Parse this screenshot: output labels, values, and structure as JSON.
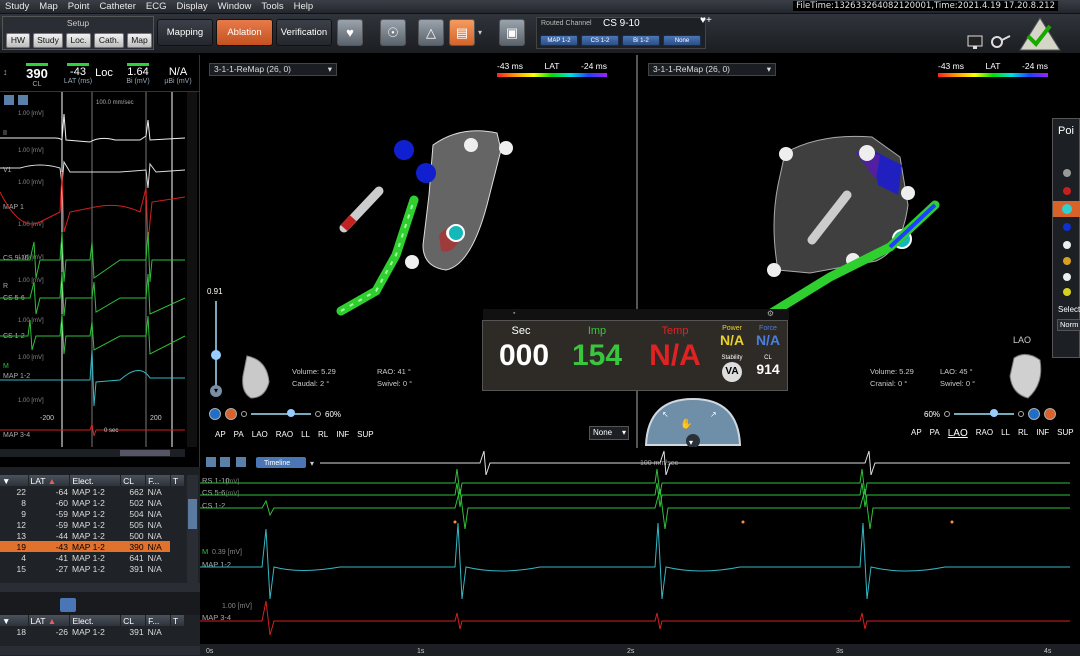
{
  "menubar": {
    "items": [
      "Study",
      "Map",
      "Point",
      "Catheter",
      "ECG",
      "Display",
      "Window",
      "Tools",
      "Help"
    ],
    "filetime": "FileTime:132633264082120001,Time:2021.4.19 17.20.8.212"
  },
  "toolbar": {
    "setup_label": "Setup",
    "setup_buttons": [
      "HW",
      "Study",
      "Loc.",
      "Cath.",
      "Map"
    ],
    "modes": [
      "Mapping",
      "Ablation",
      "Verification"
    ],
    "active_mode": "Ablation",
    "routed_label": "Routed Channel",
    "routed_value": "CS 9-10",
    "routed_buttons": [
      "MAP 1-2",
      "CS 1-2",
      "Bi 1-2",
      "None"
    ],
    "accent": "#d9622b"
  },
  "readout": {
    "cl_value": "390",
    "cl_label": "CL",
    "lat_value": "-43",
    "lat_label": "LAT (ms)",
    "loc_value": "Loc",
    "bi_value": "1.64",
    "bi_label": "Bi (mV)",
    "ubi_value": "N/A",
    "ubi_label": "µBi (mV)"
  },
  "left_ecg": {
    "speed": "100.0 mm/sec",
    "scale_labels": [
      "1.00 [mV]",
      "1.00 [mV]",
      "1.00 [mV]",
      "1.00 [mV]",
      "1.00 [mV]",
      "1.00 [mV]",
      "1.00 [mV]",
      "1.00 [mV]",
      "1.00 [mV]"
    ],
    "leads": [
      "II",
      "V1",
      "MAP 1",
      "CS 9-10",
      "R",
      "CS 5-6",
      "CS 1-2",
      "M",
      "MAP 1-2",
      "MAP 3-4"
    ],
    "time_labels": [
      "-200",
      "0 sec",
      "200"
    ]
  },
  "mapA": {
    "map_name": "3-1-1-ReMap (26, 0)",
    "lat_min": "-43 ms",
    "lat_title": "LAT",
    "lat_max": "-24 ms",
    "opacity": "0.91",
    "volume": "Volume: 5.29",
    "angle1": "RAO:",
    "angle1_val": "41 °",
    "caudal": "Caudal:",
    "caudal_val": "2 °",
    "swivel": "Swivel:",
    "swivel_val": "0 °",
    "zoom": "60%",
    "views": [
      "AP",
      "PA",
      "LAO",
      "RAO",
      "LL",
      "RL",
      "INF",
      "SUP"
    ],
    "none_select": "None"
  },
  "mapB": {
    "map_name": "3-1-1-ReMap (26, 0)",
    "lat_min": "-43 ms",
    "lat_title": "LAT",
    "lat_max": "-24 ms",
    "volume": "Volume: 5.29",
    "angle1": "LAO:",
    "angle1_val": "45 °",
    "cranial": "Cranial:",
    "cranial_val": "0 °",
    "swivel": "Swivel:",
    "swivel_val": "0 °",
    "zoom": "60%",
    "views": [
      "AP",
      "PA",
      "LAO",
      "RAO",
      "LL",
      "RL",
      "INF",
      "SUP"
    ],
    "view_label": "LAO"
  },
  "ablation": {
    "sec_label": "Sec",
    "sec_value": "000",
    "imp_label": "Imp",
    "imp_value": "154",
    "temp_label": "Temp",
    "temp_value": "N/A",
    "power_label": "Power",
    "power_value": "N/A",
    "force_label": "Force",
    "force_value": "N/A",
    "stability_label": "Stability",
    "cl_label": "CL",
    "cl_value": "914"
  },
  "pointlist": {
    "title": "Poi",
    "select_label": "Select",
    "select_value": "Norm"
  },
  "table1": {
    "headers": [
      "LAT",
      "Elect.",
      "CL",
      "F...",
      "T"
    ],
    "rows": [
      [
        "22",
        "-64",
        "MAP 1-2",
        "662",
        "N/A"
      ],
      [
        "8",
        "-60",
        "MAP 1-2",
        "502",
        "N/A"
      ],
      [
        "9",
        "-59",
        "MAP 1-2",
        "504",
        "N/A"
      ],
      [
        "12",
        "-59",
        "MAP 1-2",
        "505",
        "N/A"
      ],
      [
        "13",
        "-44",
        "MAP 1-2",
        "500",
        "N/A"
      ],
      [
        "19",
        "-43",
        "MAP 1-2",
        "390",
        "N/A"
      ],
      [
        "4",
        "-41",
        "MAP 1-2",
        "641",
        "N/A"
      ],
      [
        "15",
        "-27",
        "MAP 1-2",
        "391",
        "N/A"
      ]
    ],
    "selected_index": 5
  },
  "table2": {
    "headers": [
      "LAT",
      "Elect.",
      "CL",
      "F...",
      "T"
    ],
    "rows": [
      [
        "18",
        "-26",
        "MAP 1-2",
        "391",
        "N/A"
      ]
    ]
  },
  "strip": {
    "timeline_label": "Timeline",
    "speed": "100 mm/sec",
    "channels": [
      "RS 1-10",
      "CS 5-6",
      "CS 1-2",
      "M",
      "MAP 1-2",
      "MAP 3-4"
    ],
    "scales": [
      "[mV]",
      "[mV]",
      "0.39 [mV]",
      "1.00 [mV]"
    ],
    "time_ticks": [
      "0s",
      "1s",
      "2s",
      "3s",
      "4s"
    ]
  }
}
